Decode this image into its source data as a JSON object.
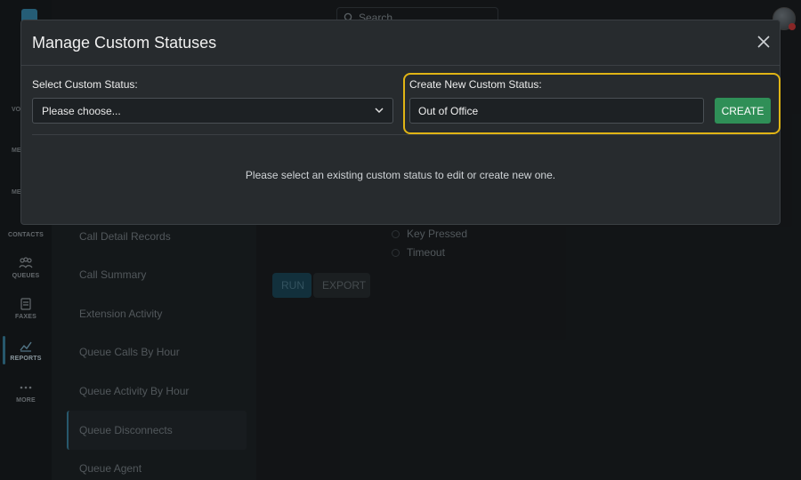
{
  "background": {
    "search_placeholder": "Search",
    "rail_partial": [
      "VO",
      "ME",
      "ME"
    ],
    "rail_items": [
      {
        "label": "CONTACTS",
        "icon": "contacts-icon"
      },
      {
        "label": "QUEUES",
        "icon": "queues-icon"
      },
      {
        "label": "FAXES",
        "icon": "fax-icon"
      },
      {
        "label": "REPORTS",
        "icon": "reports-icon"
      },
      {
        "label": "MORE",
        "icon": "more-icon"
      }
    ],
    "reports": [
      "Call Detail Records",
      "Call Summary",
      "Extension Activity",
      "Queue Calls By Hour",
      "Queue Activity By Hour",
      "Queue Disconnects",
      "Queue Agent"
    ],
    "radio_options": [
      "Key Pressed",
      "Timeout"
    ],
    "run_label": "RUN",
    "export_label": "EXPORT"
  },
  "modal": {
    "title": "Manage Custom Statuses",
    "select_label": "Select Custom Status:",
    "select_value": "Please choose...",
    "create_label": "Create New Custom Status:",
    "create_value": "Out of Office",
    "create_button": "CREATE",
    "empty_message": "Please select an existing custom status to edit or create new one."
  },
  "colors": {
    "accent_green": "#2f8f57",
    "highlight_yellow": "#e0b415",
    "active_blue": "#3d87a6"
  }
}
